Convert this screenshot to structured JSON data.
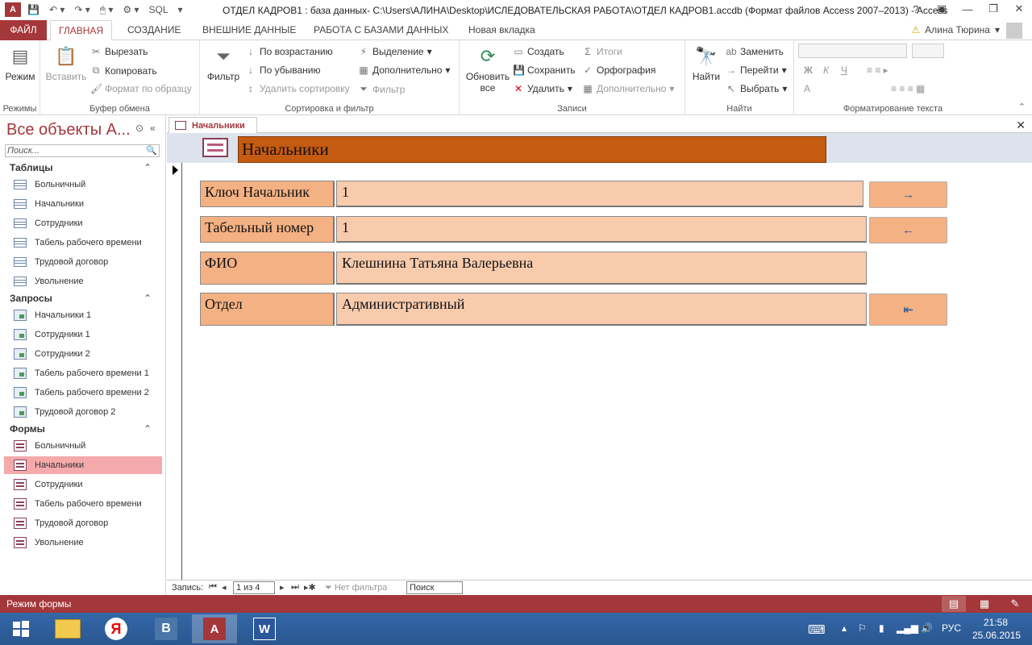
{
  "window": {
    "title": "ОТДЕЛ КАДРОВ1 : база данных- C:\\Users\\АЛИНА\\Desktop\\ИСЛЕДОВАТЕЛЬСКАЯ РАБОТА\\ОТДЕЛ КАДРОВ1.accdb (Формат файлов Access 2007–2013) - Access",
    "help": "?",
    "sql": "SQL"
  },
  "ribbon_tabs": [
    "ФАЙЛ",
    "ГЛАВНАЯ",
    "СОЗДАНИЕ",
    "ВНЕШНИЕ ДАННЫЕ",
    "РАБОТА С БАЗАМИ ДАННЫХ",
    "Новая вкладка"
  ],
  "user": "Алина Тюрина",
  "ribbon": {
    "views": {
      "mode": "Режим",
      "group": "Режимы"
    },
    "clipboard": {
      "paste": "Вставить",
      "cut": "Вырезать",
      "copy": "Копировать",
      "format_painter": "Формат по образцу",
      "group": "Буфер обмена"
    },
    "sort_filter": {
      "filter": "Фильтр",
      "ascending": "По возрастанию",
      "descending": "По убыванию",
      "remove_sort": "Удалить сортировку",
      "selection": "Выделение",
      "advanced": "Дополнительно",
      "toggle_filter": "Фильтр",
      "group": "Сортировка и фильтр"
    },
    "records": {
      "refresh_1": "Обновить",
      "refresh_2": "все",
      "new": "Создать",
      "save": "Сохранить",
      "delete": "Удалить",
      "totals": "Итоги",
      "spelling": "Орфография",
      "more": "Дополнительно",
      "group": "Записи"
    },
    "find": {
      "find": "Найти",
      "replace": "Заменить",
      "goto": "Перейти",
      "select": "Выбрать",
      "group": "Найти"
    },
    "text_format": {
      "bold": "Ж",
      "italic": "К",
      "underline": "Ч",
      "font_color": "A",
      "group": "Форматирование текста"
    }
  },
  "nav": {
    "title": "Все объекты А...",
    "search_placeholder": "Поиск...",
    "sections": [
      {
        "name": "Таблицы",
        "items": [
          "Больничный",
          "Начальники",
          "Сотрудники",
          "Табель рабочего времени",
          "Трудовой договор",
          "Увольнение"
        ]
      },
      {
        "name": "Запросы",
        "items": [
          "Начальники 1",
          "Сотрудники 1",
          "Сотрудники 2",
          "Табель рабочего времени 1",
          "Табель рабочего времени 2",
          "Трудовой договор 2"
        ]
      },
      {
        "name": "Формы",
        "items": [
          "Больничный",
          "Начальники",
          "Сотрудники",
          "Табель рабочего времени",
          "Трудовой договор",
          "Увольнение"
        ]
      }
    ]
  },
  "doc_tab": "Начальники",
  "form": {
    "title": "Начальники",
    "fields": [
      {
        "label": "Ключ Начальник",
        "value": "1"
      },
      {
        "label": "Табельный номер",
        "value": "1"
      },
      {
        "label": "ФИО",
        "value": "Клешнина Татьяна Валерьевна"
      },
      {
        "label": "Отдел",
        "value": "Административный"
      }
    ],
    "buttons": {
      "next": "→",
      "prev": "←",
      "exit": "⇤"
    }
  },
  "record_nav": {
    "label": "Запись:",
    "current": "1 из 4",
    "no_filter": "Нет фильтра",
    "search": "Поиск"
  },
  "status": {
    "text": "Режим формы"
  },
  "tray": {
    "lang": "РУС",
    "time": "21:58",
    "date": "25.06.2015"
  },
  "taskbar": {
    "browser_letter": "В"
  }
}
